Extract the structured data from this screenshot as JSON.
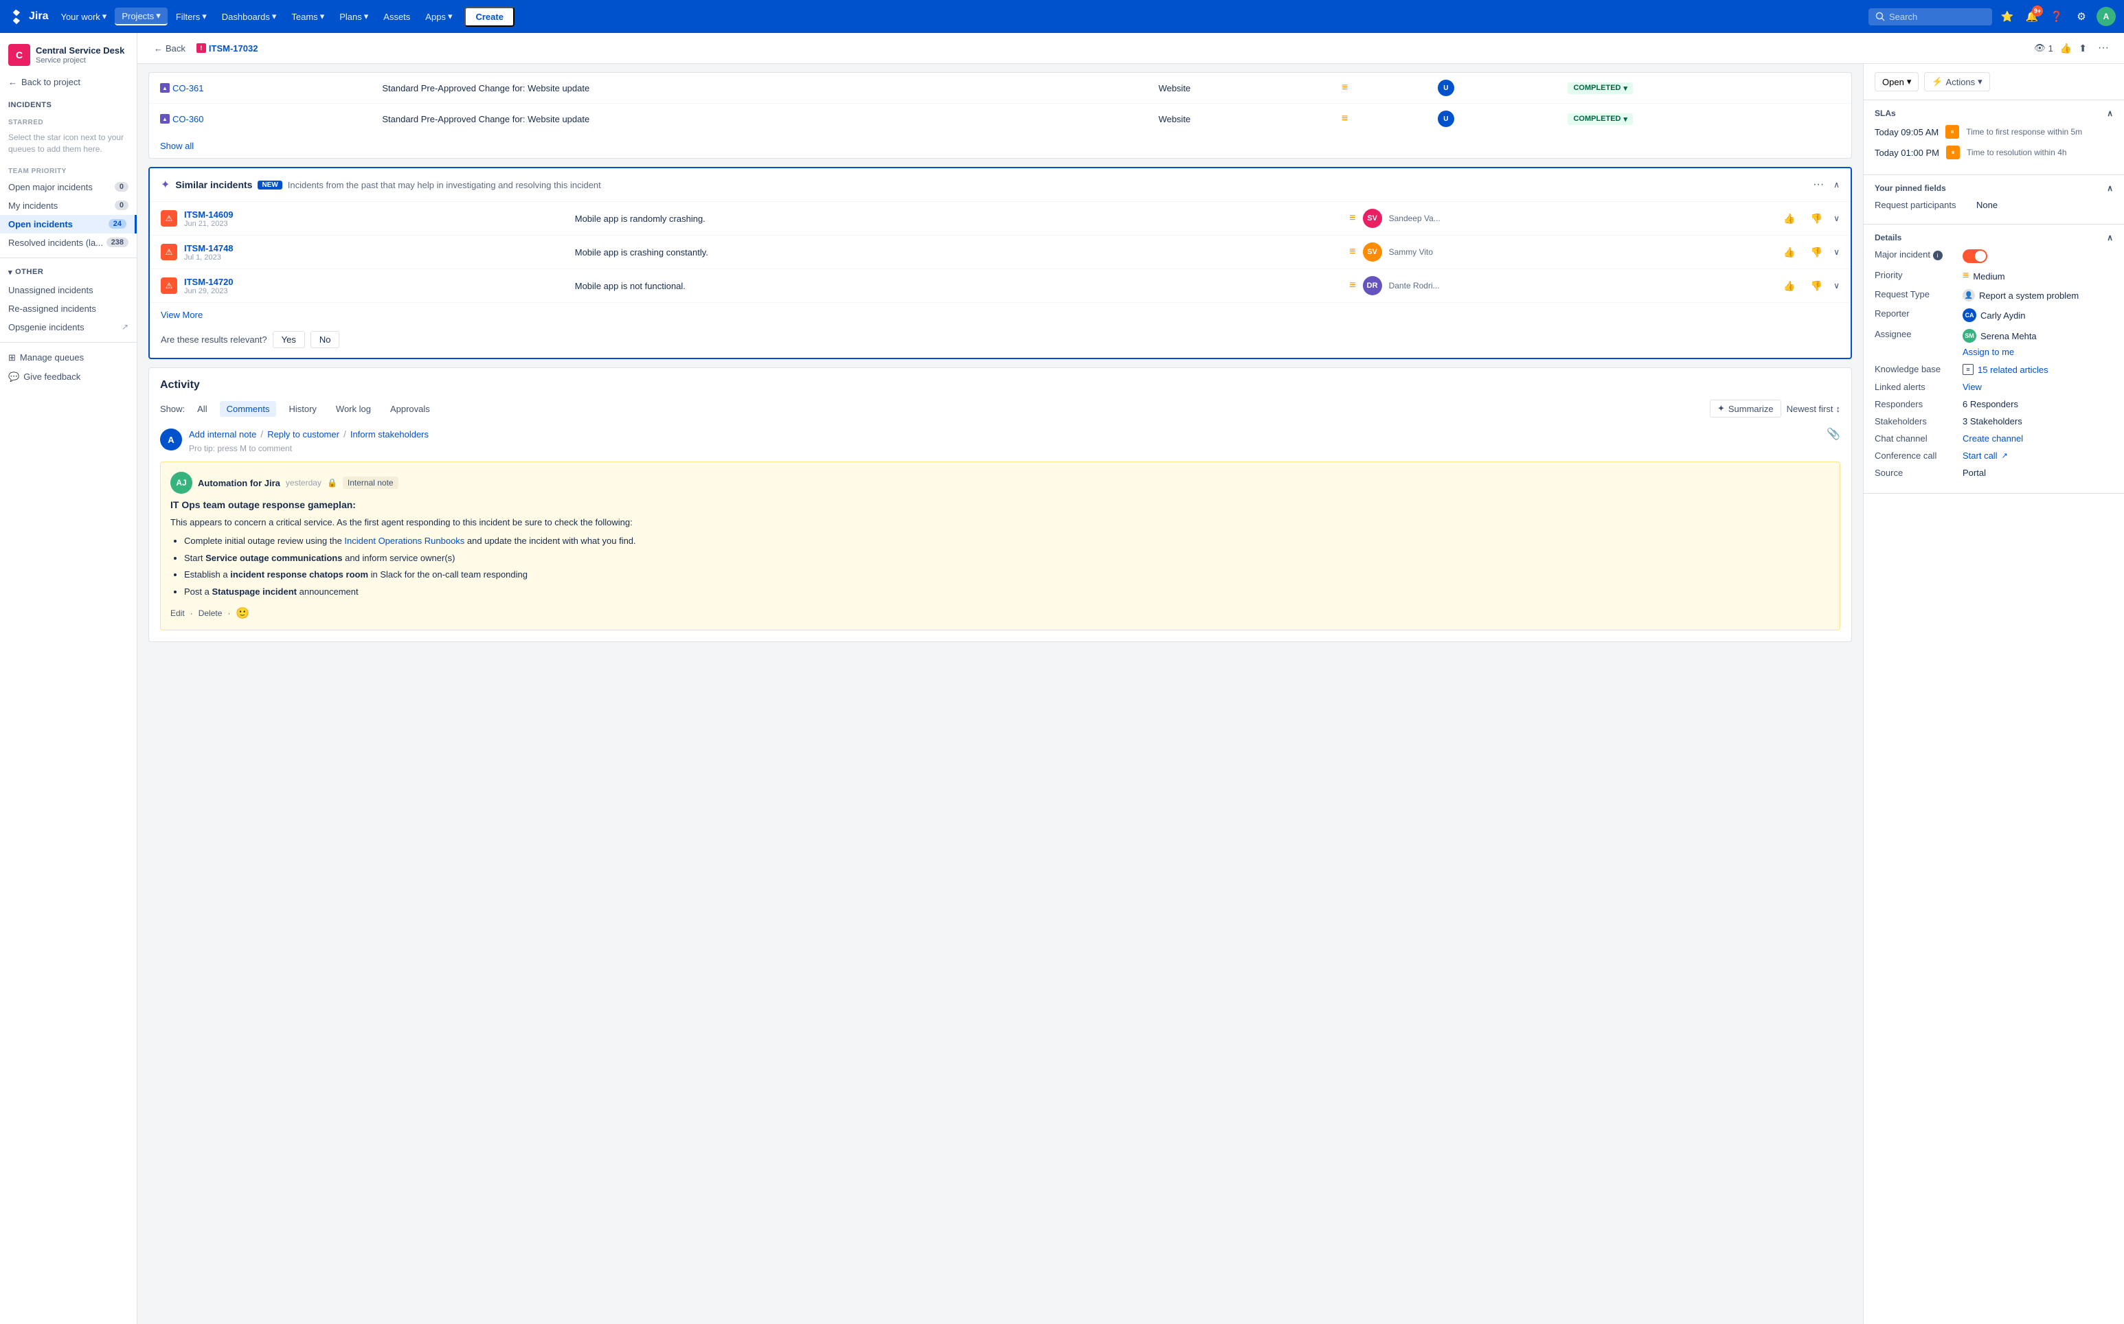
{
  "nav": {
    "logo_text": "Jira",
    "your_work": "Your work",
    "projects": "Projects",
    "filters": "Filters",
    "dashboards": "Dashboards",
    "teams": "Teams",
    "plans": "Plans",
    "assets": "Assets",
    "apps": "Apps",
    "create": "Create",
    "search_placeholder": "Search",
    "notification_count": "9+"
  },
  "sidebar": {
    "project_name": "Central Service Desk",
    "project_type": "Service project",
    "back_label": "Back to project",
    "incidents_title": "Incidents",
    "starred_label": "STARRED",
    "starred_hint": "Select the star icon next to your queues to add them here.",
    "team_priority_label": "TEAM PRIORITY",
    "items": [
      {
        "label": "Open major incidents",
        "count": "0"
      },
      {
        "label": "My incidents",
        "count": "0"
      },
      {
        "label": "Open incidents",
        "count": "24",
        "active": true
      },
      {
        "label": "Resolved incidents (la...",
        "count": "238"
      }
    ],
    "other_label": "OTHER",
    "other_items": [
      {
        "label": "Unassigned incidents"
      },
      {
        "label": "Re-assigned incidents"
      },
      {
        "label": "Opsgenie incidents",
        "has_ext": true
      }
    ],
    "manage_queues": "Manage queues",
    "give_feedback": "Give feedback"
  },
  "breadcrumb": {
    "back": "Back",
    "ticket": "ITSM-17032"
  },
  "top_right_actions": {
    "watch_count": "1",
    "open_btn": "Open",
    "actions_btn": "Actions"
  },
  "changes": {
    "rows": [
      {
        "id": "CO-361",
        "title": "Standard Pre-Approved Change for: Website update",
        "category": "Website",
        "status": "COMPLETED"
      },
      {
        "id": "CO-360",
        "title": "Standard Pre-Approved Change for: Website update",
        "category": "Website",
        "status": "COMPLETED"
      }
    ],
    "show_all": "Show all"
  },
  "similar_incidents": {
    "label": "Similar incidents",
    "new_badge": "NEW",
    "description": "Incidents from the past that may help in investigating and resolving this incident",
    "items": [
      {
        "id": "ITSM-14609",
        "date": "Jun 21, 2023",
        "description": "Mobile app is randomly crashing.",
        "assignee": "Sandeep Va..."
      },
      {
        "id": "ITSM-14748",
        "date": "Jul 1, 2023",
        "description": "Mobile app is crashing constantly.",
        "assignee": "Sammy Vito"
      },
      {
        "id": "ITSM-14720",
        "date": "Jun 29, 2023",
        "description": "Mobile app is not functional.",
        "assignee": "Dante Rodri..."
      }
    ],
    "view_more": "View More",
    "relevance_question": "Are these results relevant?",
    "yes_btn": "Yes",
    "no_btn": "No"
  },
  "activity": {
    "title": "Activity",
    "show_label": "Show:",
    "filters": [
      "All",
      "Comments",
      "History",
      "Work log",
      "Approvals"
    ],
    "active_filter": "Comments",
    "summarize_btn": "Summarize",
    "sort_btn": "Newest first",
    "add_internal_note": "Add internal note",
    "reply_to_customer": "Reply to customer",
    "inform_stakeholders": "Inform stakeholders",
    "protip": "Pro tip: press M to comment",
    "comment": {
      "author": "Automation for Jira",
      "time": "yesterday",
      "badge": "Internal note",
      "title": "IT Ops team outage response gameplan:",
      "intro": "This appears to concern a critical service. As the first agent responding to this incident be sure to check the following:",
      "bullets": [
        {
          "text": "Complete initial outage review using the ",
          "link": "Incident Operations Runbooks",
          "after": " and update the incident with what you find."
        },
        {
          "text_bold": "Service outage communications",
          "before": "Start ",
          "after": " and inform service owner(s)"
        },
        {
          "before": "Establish a ",
          "text_bold": "incident response chatops room",
          "after": " in Slack for the on-call team responding"
        },
        {
          "before": "Post a ",
          "text_bold": "Statuspage incident",
          "after": " announcement"
        }
      ],
      "edit": "Edit",
      "delete": "Delete"
    }
  },
  "right_panel": {
    "open_btn": "Open",
    "actions_btn": "Actions",
    "slas_title": "SLAs",
    "sla_items": [
      {
        "time": "Today 09:05 AM",
        "desc": "Time to first response within 5m"
      },
      {
        "time": "Today 01:00 PM",
        "desc": "Time to resolution within 4h"
      }
    ],
    "pinned_fields_title": "Your pinned fields",
    "request_participants_label": "Request participants",
    "request_participants_value": "None",
    "details_title": "Details",
    "major_incident_label": "Major incident",
    "priority_label": "Priority",
    "priority_value": "Medium",
    "request_type_label": "Request Type",
    "request_type_value": "Report a system problem",
    "reporter_label": "Reporter",
    "reporter_value": "Carly Aydin",
    "assignee_label": "Assignee",
    "assignee_value": "Serena Mehta",
    "assign_to_me": "Assign to me",
    "knowledge_base_label": "Knowledge base",
    "knowledge_base_value": "15 related articles",
    "linked_alerts_label": "Linked alerts",
    "linked_alerts_value": "View",
    "responders_label": "Responders",
    "responders_value": "6 Responders",
    "stakeholders_label": "Stakeholders",
    "stakeholders_value": "3 Stakeholders",
    "chat_channel_label": "Chat channel",
    "chat_channel_value": "Create channel",
    "conference_call_label": "Conference call",
    "conference_call_value": "Start call",
    "source_label": "Source",
    "source_value": "Portal"
  }
}
